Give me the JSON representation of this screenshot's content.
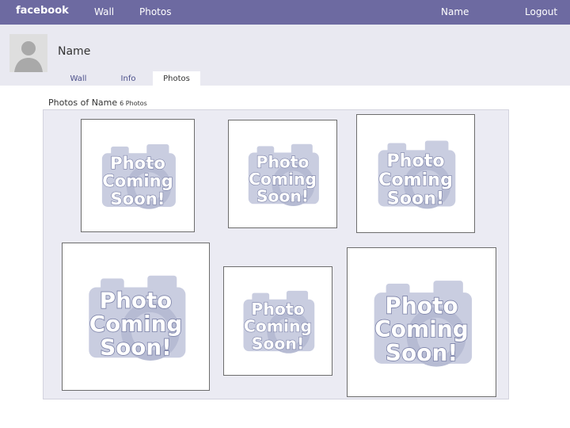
{
  "nav": {
    "brand": "facebook",
    "wall": "Wall",
    "photos": "Photos",
    "user": "Name",
    "logout": "Logout"
  },
  "profile": {
    "name": "Name",
    "tabs": [
      "Wall",
      "Info",
      "Photos"
    ],
    "active_tab": "Photos"
  },
  "album": {
    "title": "Photos of Name",
    "count": "6 Photos",
    "placeholder_lines": [
      "Photo",
      "Coming",
      "Soon!"
    ],
    "photo_count": 6
  },
  "colors": {
    "topbar": "#6d6aa1",
    "profile_band": "#e9e9f1",
    "album_bg": "#ebebf3",
    "placeholder": "#c9cde0"
  }
}
